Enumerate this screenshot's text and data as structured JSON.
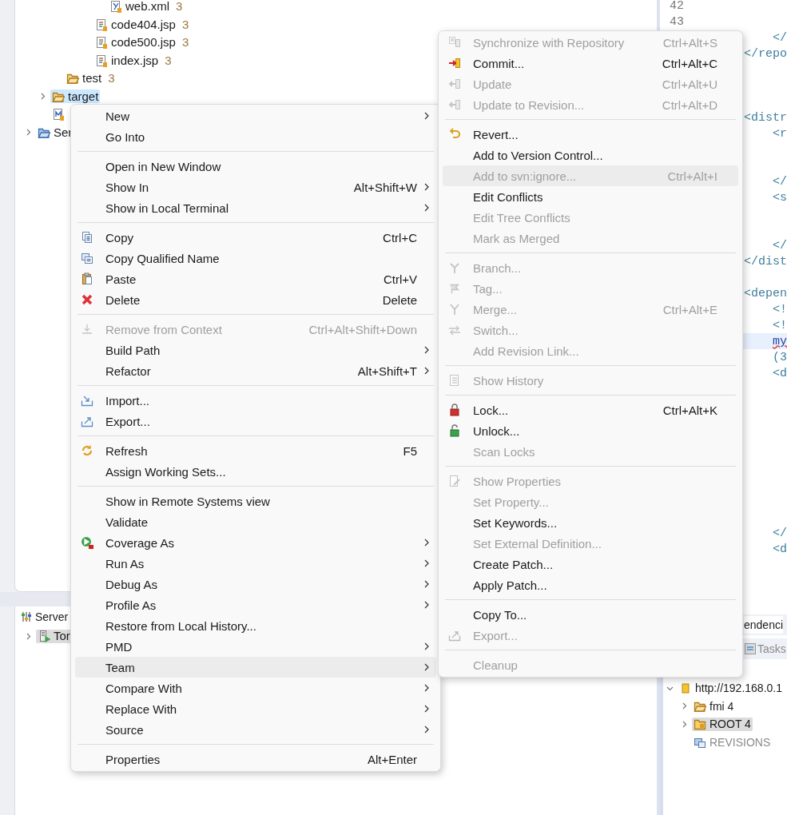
{
  "project_tree": [
    {
      "children": [
        {
          "children": [
            {
              "children": [
                {
                  "children": [
                    {
                      "children": [
                        {
                          "label": "web.xml",
                          "count": "3",
                          "kind": "xml-file",
                          "selected": false
                        }
                      ]
                    },
                    {
                      "label": "code404.jsp",
                      "count": "3",
                      "kind": "jsp-file",
                      "selected": false
                    },
                    {
                      "label": "code500.jsp",
                      "count": "3",
                      "kind": "jsp-file",
                      "selected": false
                    },
                    {
                      "label": "index.jsp",
                      "count": "3",
                      "kind": "jsp-file",
                      "selected": false
                    }
                  ]
                }
              ]
            },
            {
              "label": "test",
              "count": "3",
              "kind": "folder",
              "selected": false
            }
          ]
        },
        {
          "label": "target",
          "kind": "folder",
          "expanded": false,
          "selected": true
        },
        {
          "kind": "maven-file",
          "selected": false
        }
      ]
    },
    {
      "label": "Ser",
      "kind": "project-folder",
      "expanded": false,
      "selected": false
    }
  ],
  "editor": {
    "lines": [
      {
        "kind": "number",
        "text": "42"
      },
      {
        "kind": "number",
        "text": "43"
      },
      {
        "kind": "code",
        "text": "</",
        "indent": true,
        "current": false,
        "error": false
      },
      {
        "kind": "code",
        "text": "</repo",
        "indent": false,
        "current": false,
        "error": false
      },
      {
        "kind": "blank"
      },
      {
        "kind": "blank"
      },
      {
        "kind": "blank"
      },
      {
        "kind": "code",
        "text": "<distr",
        "indent": false,
        "current": false,
        "error": false
      },
      {
        "kind": "code",
        "text": "<r",
        "indent": true,
        "current": false,
        "error": false
      },
      {
        "kind": "blank"
      },
      {
        "kind": "blank"
      },
      {
        "kind": "code",
        "text": "</",
        "indent": true,
        "current": false,
        "error": false
      },
      {
        "kind": "code",
        "text": "<s",
        "indent": true,
        "current": false,
        "error": false
      },
      {
        "kind": "blank"
      },
      {
        "kind": "blank"
      },
      {
        "kind": "code",
        "text": "</",
        "indent": true,
        "current": false,
        "error": false
      },
      {
        "kind": "code",
        "text": "</dist",
        "indent": false,
        "current": false,
        "error": false
      },
      {
        "kind": "blank"
      },
      {
        "kind": "code",
        "text": "<depen",
        "indent": false,
        "current": false,
        "error": false
      },
      {
        "kind": "code",
        "text": "<!",
        "indent": true,
        "current": false,
        "error": false
      },
      {
        "kind": "code",
        "text": "<!",
        "indent": true,
        "current": false,
        "error": false
      },
      {
        "kind": "code",
        "text": "my",
        "indent": true,
        "current": true,
        "error": true
      },
      {
        "kind": "code",
        "text": "(3",
        "indent": true,
        "current": false,
        "error": false
      },
      {
        "kind": "code",
        "text": "<d",
        "indent": true,
        "current": false,
        "error": false
      },
      {
        "kind": "blank"
      },
      {
        "kind": "blank"
      },
      {
        "kind": "blank"
      },
      {
        "kind": "blank"
      },
      {
        "kind": "blank"
      },
      {
        "kind": "blank"
      },
      {
        "kind": "blank"
      },
      {
        "kind": "blank"
      },
      {
        "kind": "blank"
      },
      {
        "kind": "code",
        "text": "</",
        "indent": true,
        "current": false,
        "error": false
      },
      {
        "kind": "code",
        "text": "<d",
        "indent": true,
        "current": false,
        "error": false
      }
    ]
  },
  "servers_panel": {
    "tab": {
      "label": "Server"
    },
    "items": [
      {
        "label": "Tor",
        "kind": "server",
        "expanded": false,
        "selected": true
      }
    ]
  },
  "repository_panel": {
    "tabs": [
      {
        "label": "endenci",
        "selected": true
      },
      {
        "label": "Tasks",
        "selected": false
      }
    ],
    "tree": [
      {
        "label": "http://192.168.0.1",
        "kind": "repository",
        "expanded": true,
        "selected": false,
        "disabled": false,
        "children": [
          {
            "label": "fmi 4",
            "kind": "folder",
            "expanded": false,
            "selected": false,
            "disabled": false
          },
          {
            "label": "ROOT 4",
            "kind": "locked-folder",
            "expanded": false,
            "selected": true,
            "disabled": false
          },
          {
            "label": "REVISIONS",
            "kind": "revisions",
            "selected": false,
            "disabled": true
          }
        ]
      }
    ]
  },
  "context_menu": {
    "items": [
      {
        "kind": "item",
        "label": "New",
        "submenu": true,
        "disabled": false,
        "highlighted": false
      },
      {
        "kind": "item",
        "label": "Go Into",
        "submenu": false,
        "disabled": false,
        "highlighted": false
      },
      {
        "kind": "separator"
      },
      {
        "kind": "item",
        "label": "Open in New Window",
        "submenu": false,
        "disabled": false,
        "highlighted": false
      },
      {
        "kind": "item",
        "label": "Show In",
        "shortcut": "Alt+Shift+W",
        "submenu": true,
        "disabled": false,
        "highlighted": false
      },
      {
        "kind": "item",
        "label": "Show in Local Terminal",
        "submenu": true,
        "disabled": false,
        "highlighted": false
      },
      {
        "kind": "separator"
      },
      {
        "kind": "copy",
        "label": "Copy",
        "shortcut": "Ctrl+C",
        "submenu": false,
        "disabled": false,
        "highlighted": false
      },
      {
        "kind": "copy-qualified",
        "label": "Copy Qualified Name",
        "submenu": false,
        "disabled": false,
        "highlighted": false
      },
      {
        "kind": "paste",
        "label": "Paste",
        "shortcut": "Ctrl+V",
        "submenu": false,
        "disabled": false,
        "highlighted": false
      },
      {
        "kind": "delete",
        "label": "Delete",
        "shortcut": "Delete",
        "submenu": false,
        "disabled": false,
        "highlighted": false
      },
      {
        "kind": "separator"
      },
      {
        "kind": "remove-context",
        "label": "Remove from Context",
        "shortcut": "Ctrl+Alt+Shift+Down",
        "submenu": false,
        "disabled": true,
        "highlighted": false
      },
      {
        "kind": "item",
        "label": "Build Path",
        "submenu": true,
        "disabled": false,
        "highlighted": false
      },
      {
        "kind": "item",
        "label": "Refactor",
        "shortcut": "Alt+Shift+T",
        "submenu": true,
        "disabled": false,
        "highlighted": false
      },
      {
        "kind": "separator"
      },
      {
        "kind": "import",
        "label": "Import...",
        "submenu": false,
        "disabled": false,
        "highlighted": false
      },
      {
        "kind": "export",
        "label": "Export...",
        "submenu": false,
        "disabled": false,
        "highlighted": false
      },
      {
        "kind": "separator"
      },
      {
        "kind": "refresh",
        "label": "Refresh",
        "shortcut": "F5",
        "submenu": false,
        "disabled": false,
        "highlighted": false
      },
      {
        "kind": "item",
        "label": "Assign Working Sets...",
        "submenu": false,
        "disabled": false,
        "highlighted": false
      },
      {
        "kind": "separator"
      },
      {
        "kind": "item",
        "label": "Show in Remote Systems view",
        "submenu": false,
        "disabled": false,
        "highlighted": false
      },
      {
        "kind": "item",
        "label": "Validate",
        "submenu": false,
        "disabled": false,
        "highlighted": false
      },
      {
        "kind": "coverage",
        "label": "Coverage As",
        "submenu": true,
        "disabled": false,
        "highlighted": false
      },
      {
        "kind": "item",
        "label": "Run As",
        "submenu": true,
        "disabled": false,
        "highlighted": false
      },
      {
        "kind": "item",
        "label": "Debug As",
        "submenu": true,
        "disabled": false,
        "highlighted": false
      },
      {
        "kind": "item",
        "label": "Profile As",
        "submenu": true,
        "disabled": false,
        "highlighted": false
      },
      {
        "kind": "item",
        "label": "Restore from Local History...",
        "submenu": false,
        "disabled": false,
        "highlighted": false
      },
      {
        "kind": "item",
        "label": "PMD",
        "submenu": true,
        "disabled": false,
        "highlighted": false
      },
      {
        "kind": "item",
        "label": "Team",
        "submenu": true,
        "disabled": false,
        "highlighted": true
      },
      {
        "kind": "item",
        "label": "Compare With",
        "submenu": true,
        "disabled": false,
        "highlighted": false
      },
      {
        "kind": "item",
        "label": "Replace With",
        "submenu": true,
        "disabled": false,
        "highlighted": false
      },
      {
        "kind": "item",
        "label": "Source",
        "submenu": true,
        "disabled": false,
        "highlighted": false
      },
      {
        "kind": "separator"
      },
      {
        "kind": "item",
        "label": "Properties",
        "shortcut": "Alt+Enter",
        "submenu": false,
        "disabled": false,
        "highlighted": false
      }
    ]
  },
  "team_submenu": {
    "items": [
      {
        "kind": "sync",
        "label": "Synchronize with Repository",
        "shortcut": "Ctrl+Alt+S",
        "disabled": true,
        "highlighted": false
      },
      {
        "kind": "commit",
        "label": "Commit...",
        "shortcut": "Ctrl+Alt+C",
        "disabled": false,
        "highlighted": false
      },
      {
        "kind": "update",
        "label": "Update",
        "shortcut": "Ctrl+Alt+U",
        "disabled": true,
        "highlighted": false
      },
      {
        "kind": "update",
        "label": "Update to Revision...",
        "shortcut": "Ctrl+Alt+D",
        "disabled": true,
        "highlighted": false
      },
      {
        "kind": "separator"
      },
      {
        "kind": "revert",
        "label": "Revert...",
        "disabled": false,
        "highlighted": false
      },
      {
        "kind": "item",
        "label": "Add to Version Control...",
        "disabled": false,
        "highlighted": false
      },
      {
        "kind": "item",
        "label": "Add to svn:ignore...",
        "shortcut": "Ctrl+Alt+I",
        "disabled": true,
        "highlighted": true
      },
      {
        "kind": "item",
        "label": "Edit Conflicts",
        "disabled": false,
        "highlighted": false
      },
      {
        "kind": "item",
        "label": "Edit Tree Conflicts",
        "disabled": true,
        "highlighted": false
      },
      {
        "kind": "item",
        "label": "Mark as Merged",
        "disabled": true,
        "highlighted": false
      },
      {
        "kind": "separator"
      },
      {
        "kind": "branch",
        "label": "Branch...",
        "disabled": true,
        "highlighted": false
      },
      {
        "kind": "tag",
        "label": "Tag...",
        "disabled": true,
        "highlighted": false
      },
      {
        "kind": "merge",
        "label": "Merge...",
        "shortcut": "Ctrl+Alt+E",
        "disabled": true,
        "highlighted": false
      },
      {
        "kind": "switch",
        "label": "Switch...",
        "disabled": true,
        "highlighted": false
      },
      {
        "kind": "item",
        "label": "Add Revision Link...",
        "disabled": true,
        "highlighted": false
      },
      {
        "kind": "separator"
      },
      {
        "kind": "history",
        "label": "Show History",
        "disabled": true,
        "highlighted": false
      },
      {
        "kind": "separator"
      },
      {
        "kind": "lock",
        "label": "Lock...",
        "shortcut": "Ctrl+Alt+K",
        "disabled": false,
        "highlighted": false
      },
      {
        "kind": "unlock",
        "label": "Unlock...",
        "disabled": false,
        "highlighted": false
      },
      {
        "kind": "item",
        "label": "Scan Locks",
        "disabled": true,
        "highlighted": false
      },
      {
        "kind": "separator"
      },
      {
        "kind": "properties",
        "label": "Show Properties",
        "disabled": true,
        "highlighted": false
      },
      {
        "kind": "item",
        "label": "Set Property...",
        "disabled": true,
        "highlighted": false
      },
      {
        "kind": "item",
        "label": "Set Keywords...",
        "disabled": false,
        "highlighted": false
      },
      {
        "kind": "item",
        "label": "Set External Definition...",
        "disabled": true,
        "highlighted": false
      },
      {
        "kind": "item",
        "label": "Create Patch...",
        "disabled": false,
        "highlighted": false
      },
      {
        "kind": "item",
        "label": "Apply Patch...",
        "disabled": false,
        "highlighted": false
      },
      {
        "kind": "separator"
      },
      {
        "kind": "item",
        "label": "Copy To...",
        "disabled": false,
        "highlighted": false
      },
      {
        "kind": "export",
        "label": "Export...",
        "disabled": true,
        "highlighted": false
      },
      {
        "kind": "separator"
      },
      {
        "kind": "item",
        "label": "Cleanup",
        "disabled": true,
        "highlighted": false
      }
    ]
  }
}
